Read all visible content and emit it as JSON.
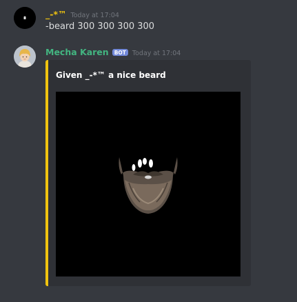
{
  "messages": [
    {
      "username": "_-*™",
      "timestamp": "Today at 17:04",
      "text": "-beard 300 300 300 300",
      "avatar_icon": "dark-avatar-icon"
    },
    {
      "username": "Mecha Karen",
      "bot_tag": "BOT",
      "timestamp": "Today at 17:04",
      "avatar_icon": "blonde-person-avatar-icon",
      "embed": {
        "accent_color": "#f1c40f",
        "title": "Given _-*™ a nice beard",
        "image": "beard-image"
      }
    }
  ],
  "colors": {
    "background": "#36393f",
    "embed_background": "#2f3136",
    "username_1": "#f1c40f",
    "username_2": "#43b581",
    "bot_tag": "#7289da",
    "timestamp": "#72767d"
  }
}
